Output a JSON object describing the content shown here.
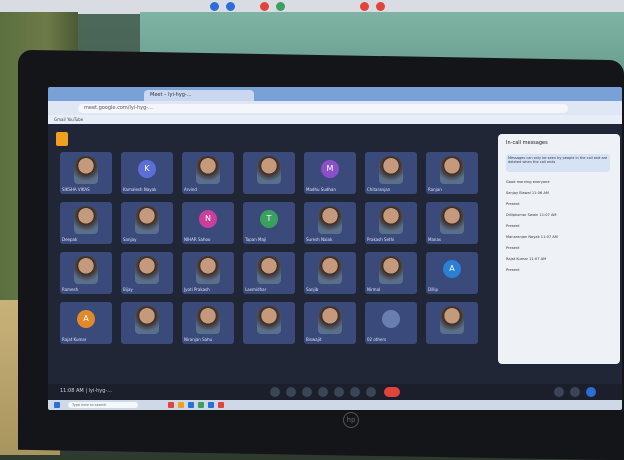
{
  "scene": {
    "description_hidden": "",
    "laptop_brand_mark": "hp"
  },
  "browser": {
    "tab_title": "Meet – lyi-hyg-...",
    "address": "meet.google.com/lyi-hyg-...",
    "bookmarks": "Gmail   YouTube"
  },
  "meet": {
    "participants": [
      {
        "name": "SIKSHA VIKAS",
        "initial": "",
        "color": "#6a7fb0",
        "photo": true
      },
      {
        "name": "Kamalesh Nayak",
        "initial": "K",
        "color": "#5b6fd6",
        "photo": false
      },
      {
        "name": "Arvind",
        "initial": "",
        "color": "#6a7fb0",
        "photo": true
      },
      {
        "name": "",
        "initial": "",
        "color": "#6a7fb0",
        "photo": true
      },
      {
        "name": "Madhu Sudhan",
        "initial": "M",
        "color": "#8a4fc9",
        "photo": false
      },
      {
        "name": "Chitaranjan",
        "initial": "",
        "color": "#6a7fb0",
        "photo": true
      },
      {
        "name": "Ranjan",
        "initial": "",
        "color": "#6a7fb0",
        "photo": true
      },
      {
        "name": "Deepak",
        "initial": "",
        "color": "#6a7fb0",
        "photo": true
      },
      {
        "name": "Sanjay",
        "initial": "",
        "color": "#6a7fb0",
        "photo": true
      },
      {
        "name": "NIHAR Sahoo",
        "initial": "N",
        "color": "#c9409a",
        "photo": false
      },
      {
        "name": "Tapan Maji",
        "initial": "T",
        "color": "#3aa060",
        "photo": false
      },
      {
        "name": "Suresh Naiak",
        "initial": "",
        "color": "#6a7fb0",
        "photo": true
      },
      {
        "name": "Prakash Sethi",
        "initial": "",
        "color": "#6a7fb0",
        "photo": true
      },
      {
        "name": "Manas",
        "initial": "",
        "color": "#6a7fb0",
        "photo": true
      },
      {
        "name": "Ramesh",
        "initial": "",
        "color": "#6a7fb0",
        "photo": true
      },
      {
        "name": "Bijay",
        "initial": "",
        "color": "#6a7fb0",
        "photo": true
      },
      {
        "name": "Jyoti Prakash",
        "initial": "",
        "color": "#6a7fb0",
        "photo": true
      },
      {
        "name": "Laxmidhar",
        "initial": "",
        "color": "#6a7fb0",
        "photo": true
      },
      {
        "name": "Sanjib",
        "initial": "",
        "color": "#6a7fb0",
        "photo": true
      },
      {
        "name": "Nirmal",
        "initial": "",
        "color": "#6a7fb0",
        "photo": true
      },
      {
        "name": "Dillip",
        "initial": "A",
        "color": "#2a7fd6",
        "photo": false
      },
      {
        "name": "Rajat Kumar",
        "initial": "A",
        "color": "#e08a2a",
        "photo": false
      },
      {
        "name": "",
        "initial": "",
        "color": "#6a7fb0",
        "photo": true
      },
      {
        "name": "Niranjan Sahu",
        "initial": "",
        "color": "#6a7fb0",
        "photo": true
      },
      {
        "name": "",
        "initial": "",
        "color": "#6a7fb0",
        "photo": true
      },
      {
        "name": "Biswajit",
        "initial": "",
        "color": "#6a7fb0",
        "photo": true
      },
      {
        "name": "02 others",
        "initial": "",
        "color": "#6a7fb0",
        "photo": false
      },
      {
        "name": "",
        "initial": "",
        "color": "#6a7fb0",
        "photo": true
      }
    ],
    "panel": {
      "title": "In-call messages",
      "note": "Messages can only be seen by people in the call and are deleted when the call ends",
      "messages": [
        "Good morning everyone",
        "Sanjay Biswal  11:06 AM",
        "Present",
        "Dillipkumar Swain  11:07 AM",
        "Present",
        "Manoranjan Nayak  11:07 AM",
        "Present",
        "Rajat Kumar  11:07 AM",
        "Present"
      ]
    },
    "controls": {
      "time": "11:08 AM  |  lyi-hyg-..."
    }
  },
  "taskbar": {
    "search_placeholder": "Type here to search"
  }
}
